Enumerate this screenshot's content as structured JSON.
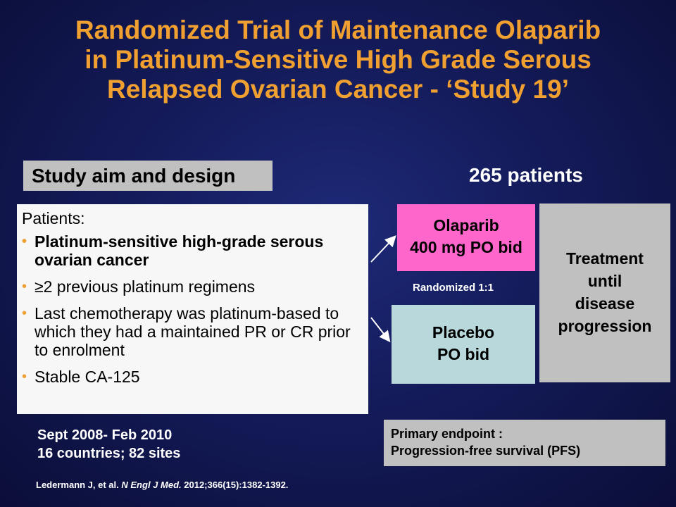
{
  "title": {
    "line1": "Randomized Trial of Maintenance Olaparib",
    "line2": "in Platinum-Sensitive High Grade Serous",
    "line3": "Relapsed Ovarian Cancer - ‘Study 19’"
  },
  "aim_label": "Study aim and design",
  "patients_count": "265 patients",
  "patients": {
    "heading": "Patients:",
    "items": [
      "Platinum-sensitive high-grade serous ovarian cancer",
      "≥2 previous platinum regimens",
      "Last chemotherapy was platinum-based to which they had a maintained PR or CR prior to enrolment",
      "Stable CA-125"
    ]
  },
  "arms": {
    "olaparib_line1": "Olaparib",
    "olaparib_line2": "400 mg PO bid",
    "placebo_line1": "Placebo",
    "placebo_line2": "PO bid",
    "randomized": "Randomized 1:1"
  },
  "treatment": {
    "line1": "Treatment",
    "line2": "until",
    "line3": "disease",
    "line4": "progression"
  },
  "study_info": {
    "dates": "Sept 2008- Feb 2010",
    "sites": "16 countries; 82 sites"
  },
  "endpoint": {
    "line1": "Primary endpoint :",
    "line2": "Progression-free survival (PFS)"
  },
  "citation": {
    "authors": "Ledermann J, et al.",
    "journal": "N Engl J Med.",
    "ref": "2012;366(15):1382-1392."
  },
  "colors": {
    "title": "#f0a030",
    "olaparib_box": "#ff66cc",
    "placebo_box": "#b8d8dc",
    "gray_box": "#c0c0c0",
    "background": "#141b5a"
  }
}
